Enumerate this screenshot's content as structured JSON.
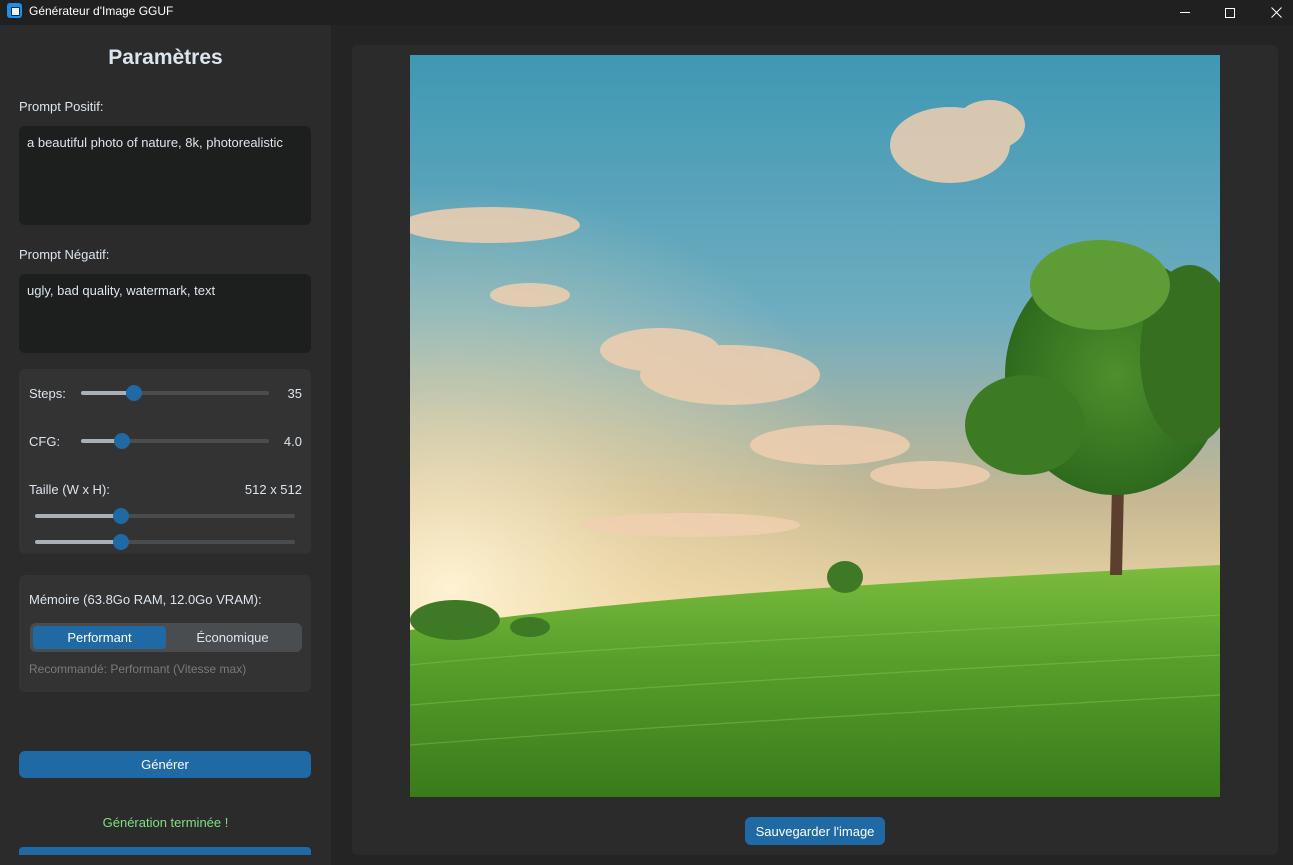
{
  "window": {
    "title": "Générateur d'Image GGUF"
  },
  "sidebar": {
    "title": "Paramètres",
    "positive_label": "Prompt Positif:",
    "positive_value": "a beautiful photo of nature, 8k, photorealistic",
    "negative_label": "Prompt Négatif:",
    "negative_value": "ugly, bad quality, watermark, text",
    "steps": {
      "label": "Steps:",
      "value": "35",
      "fraction": 0.28
    },
    "cfg": {
      "label": "CFG:",
      "value": "4.0",
      "fraction": 0.22
    },
    "size": {
      "label": "Taille (W x H):",
      "value": "512 x 512",
      "width_fraction": 0.33,
      "height_fraction": 0.33
    },
    "memory": {
      "label": "Mémoire (63.8Go RAM, 12.0Go VRAM):",
      "options": [
        "Performant",
        "Économique"
      ],
      "selected": "Performant",
      "hint": "Recommandé: Performant (Vitesse max)"
    },
    "generate_label": "Générer",
    "status": "Génération terminée !"
  },
  "main": {
    "save_label": "Sauvegarder l'image"
  },
  "colors": {
    "accent": "#1f6aa5",
    "status_green": "#7ee07e",
    "panel": "#2b2b2b"
  }
}
